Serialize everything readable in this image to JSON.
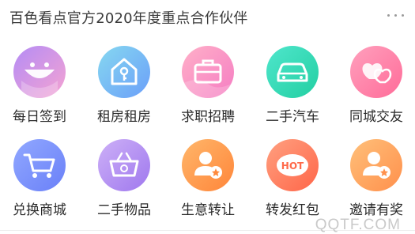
{
  "header": {
    "title": "百色看点官方2020年度重点合作伙伴",
    "more_icon": "more-dots-icon"
  },
  "grid": {
    "items": [
      {
        "label": "每日签到",
        "icon": "sign-in-smile-icon",
        "colors": [
          "#c78bf0",
          "#f0a6d7"
        ]
      },
      {
        "label": "租房租房",
        "icon": "house-key-icon",
        "colors": [
          "#7fd3f2",
          "#6aa6f8"
        ]
      },
      {
        "label": "求职招聘",
        "icon": "briefcase-icon",
        "colors": [
          "#ffa8c5",
          "#f77fc1"
        ]
      },
      {
        "label": "二手汽车",
        "icon": "car-icon",
        "colors": [
          "#45e3c8",
          "#26d3a5"
        ]
      },
      {
        "label": "同城交友",
        "icon": "hearts-icon",
        "colors": [
          "#ff9db9",
          "#ff6f9b"
        ]
      },
      {
        "label": "兑换商城",
        "icon": "cart-icon",
        "colors": [
          "#8aa2ff",
          "#6a82fb"
        ]
      },
      {
        "label": "二手物品",
        "icon": "basket-icon",
        "colors": [
          "#c3a7f7",
          "#a77ef0"
        ]
      },
      {
        "label": "生意转让",
        "icon": "user-star-icon",
        "colors": [
          "#ffb066",
          "#ff8a3d"
        ]
      },
      {
        "label": "转发红包",
        "icon": "hot-badge-icon",
        "colors": [
          "#ff9a7a",
          "#ff6a4a"
        ]
      },
      {
        "label": "邀请有奖",
        "icon": "user-badge-icon",
        "colors": [
          "#ffbb73",
          "#ff914d"
        ]
      }
    ]
  },
  "watermark": "QQTF.COM"
}
